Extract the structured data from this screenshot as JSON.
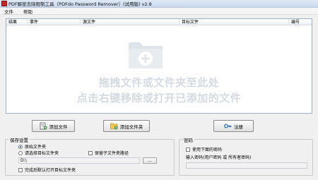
{
  "window": {
    "title": "PDF解密去除限制工具（PDFdo Password Remover）(试用版) v2.8"
  },
  "menu": {
    "items": [
      "文件",
      "帮助"
    ]
  },
  "table": {
    "columns": [
      "结果",
      "事件",
      "源文件",
      "目标文件",
      "编号"
    ]
  },
  "drop_hint": {
    "line1": "拖拽文件或文件夹至此处",
    "line2": "点击右键移除或打开已添加的文件"
  },
  "buttons": {
    "add_file": "添加文件",
    "add_folder": "添加文件夹",
    "register": "注册"
  },
  "save_settings": {
    "title": "保存设置",
    "option_original": "原始文件夹",
    "option_choose": "请选择目标文件夹",
    "keep_subfolder": "保留子文件夹路径",
    "path_value": "D:\\",
    "browse_label": "...",
    "open_after": "完成后默认打开目标文件夹"
  },
  "password": {
    "title": "密码",
    "use_password": "使用下面的密码",
    "prompt": "输入密码(用户密码 或 所有者密码)"
  },
  "colors": {
    "accent": "#1b4fa0",
    "app_icon": "#c62828",
    "drop_text": "#d4dae2"
  },
  "icons": {
    "app": "pdf-app-icon",
    "drop": "folder-plus-icon",
    "add_file": "add-file-icon",
    "add_folder": "add-folder-icon",
    "register": "key-icon"
  }
}
